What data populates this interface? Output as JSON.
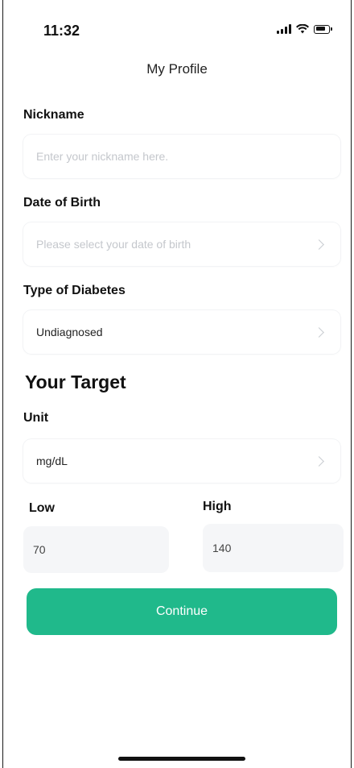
{
  "status_bar": {
    "time": "11:32"
  },
  "header": {
    "title": "My Profile"
  },
  "form": {
    "nickname": {
      "label": "Nickname",
      "placeholder": "Enter your nickname here.",
      "value": ""
    },
    "dob": {
      "label": "Date of Birth",
      "placeholder": "Please select your date of birth"
    },
    "diabetes_type": {
      "label": "Type of Diabetes",
      "value": "Undiagnosed"
    }
  },
  "target": {
    "title": "Your Target",
    "unit": {
      "label": "Unit",
      "value": "mg/dL"
    },
    "low": {
      "label": "Low",
      "value": "70"
    },
    "high": {
      "label": "High",
      "value": "140"
    }
  },
  "actions": {
    "continue_label": "Continue"
  },
  "colors": {
    "accent": "#20b98b",
    "field_bg": "#f5f6f8",
    "placeholder": "#c4c7cc"
  },
  "icons": [
    "signal-icon",
    "wifi-icon",
    "battery-icon",
    "chevron-right-icon"
  ]
}
